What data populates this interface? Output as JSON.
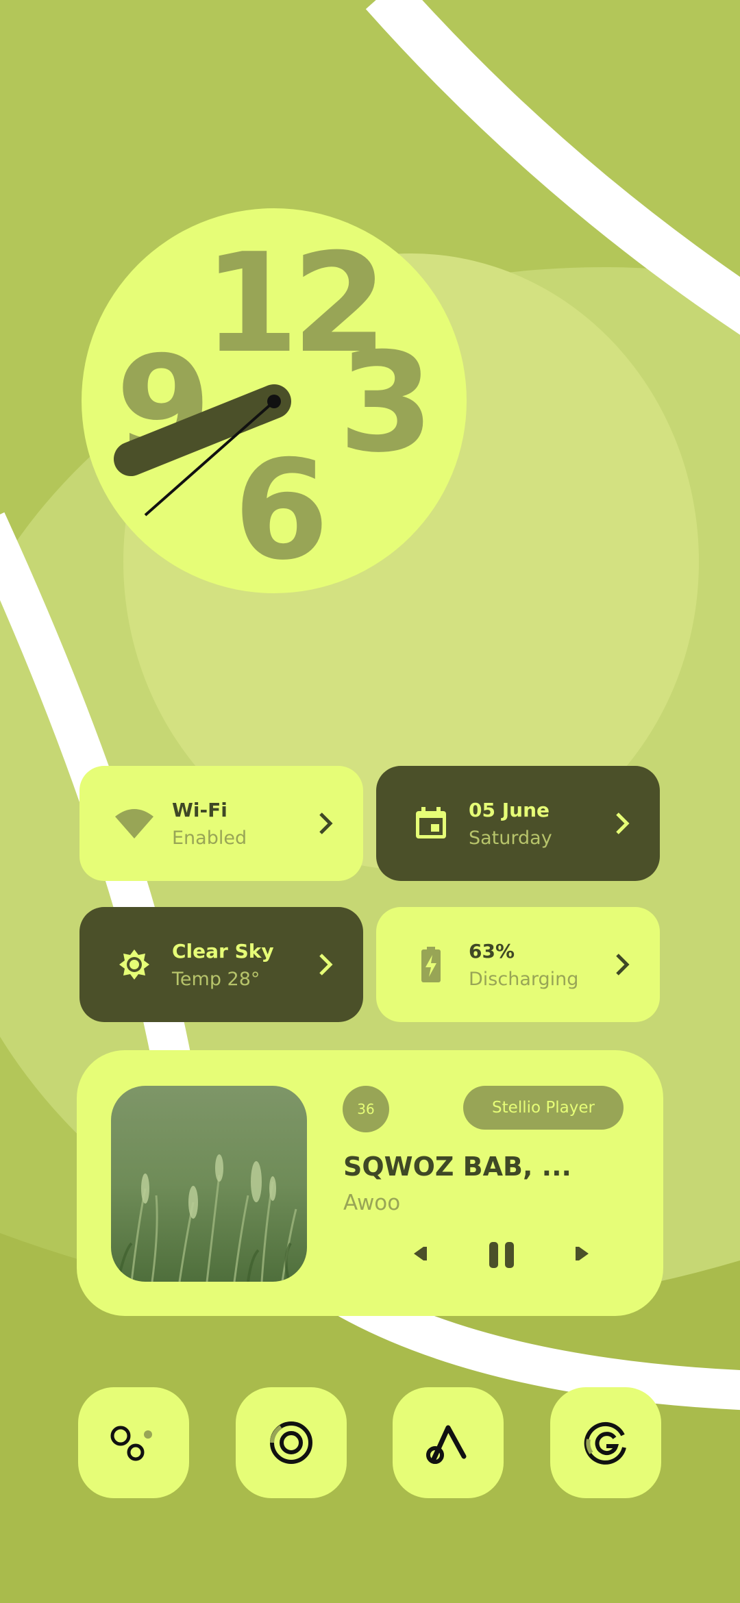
{
  "colors": {
    "background": "#a9bb4c",
    "accent_light": "#e6fd77",
    "accent_dark": "#4b5029",
    "muted": "#98a556",
    "text_dark": "#3f4826"
  },
  "clock": {
    "numerals": [
      "12",
      "3",
      "6",
      "9"
    ]
  },
  "tiles": [
    {
      "icon": "wifi-icon",
      "title": "Wi-Fi",
      "subtitle": "Enabled"
    },
    {
      "icon": "calendar-icon",
      "title": "05 June",
      "subtitle": "Saturday"
    },
    {
      "icon": "sun-icon",
      "title": "Clear Sky",
      "subtitle": "Temp 28°"
    },
    {
      "icon": "battery-charging-icon",
      "title": "63%",
      "subtitle": "Discharging"
    }
  ],
  "media": {
    "track_number": "36",
    "player_name": "Stellio Player",
    "song_title": "SQWOZ BAB, ...",
    "artist": "Awoo",
    "controls": [
      "previous-icon",
      "pause-icon",
      "next-icon"
    ]
  },
  "dock": [
    {
      "icon": "circles-app-icon"
    },
    {
      "icon": "ring-app-icon"
    },
    {
      "icon": "triangle-loop-app-icon"
    },
    {
      "icon": "spiral-g-app-icon"
    }
  ]
}
